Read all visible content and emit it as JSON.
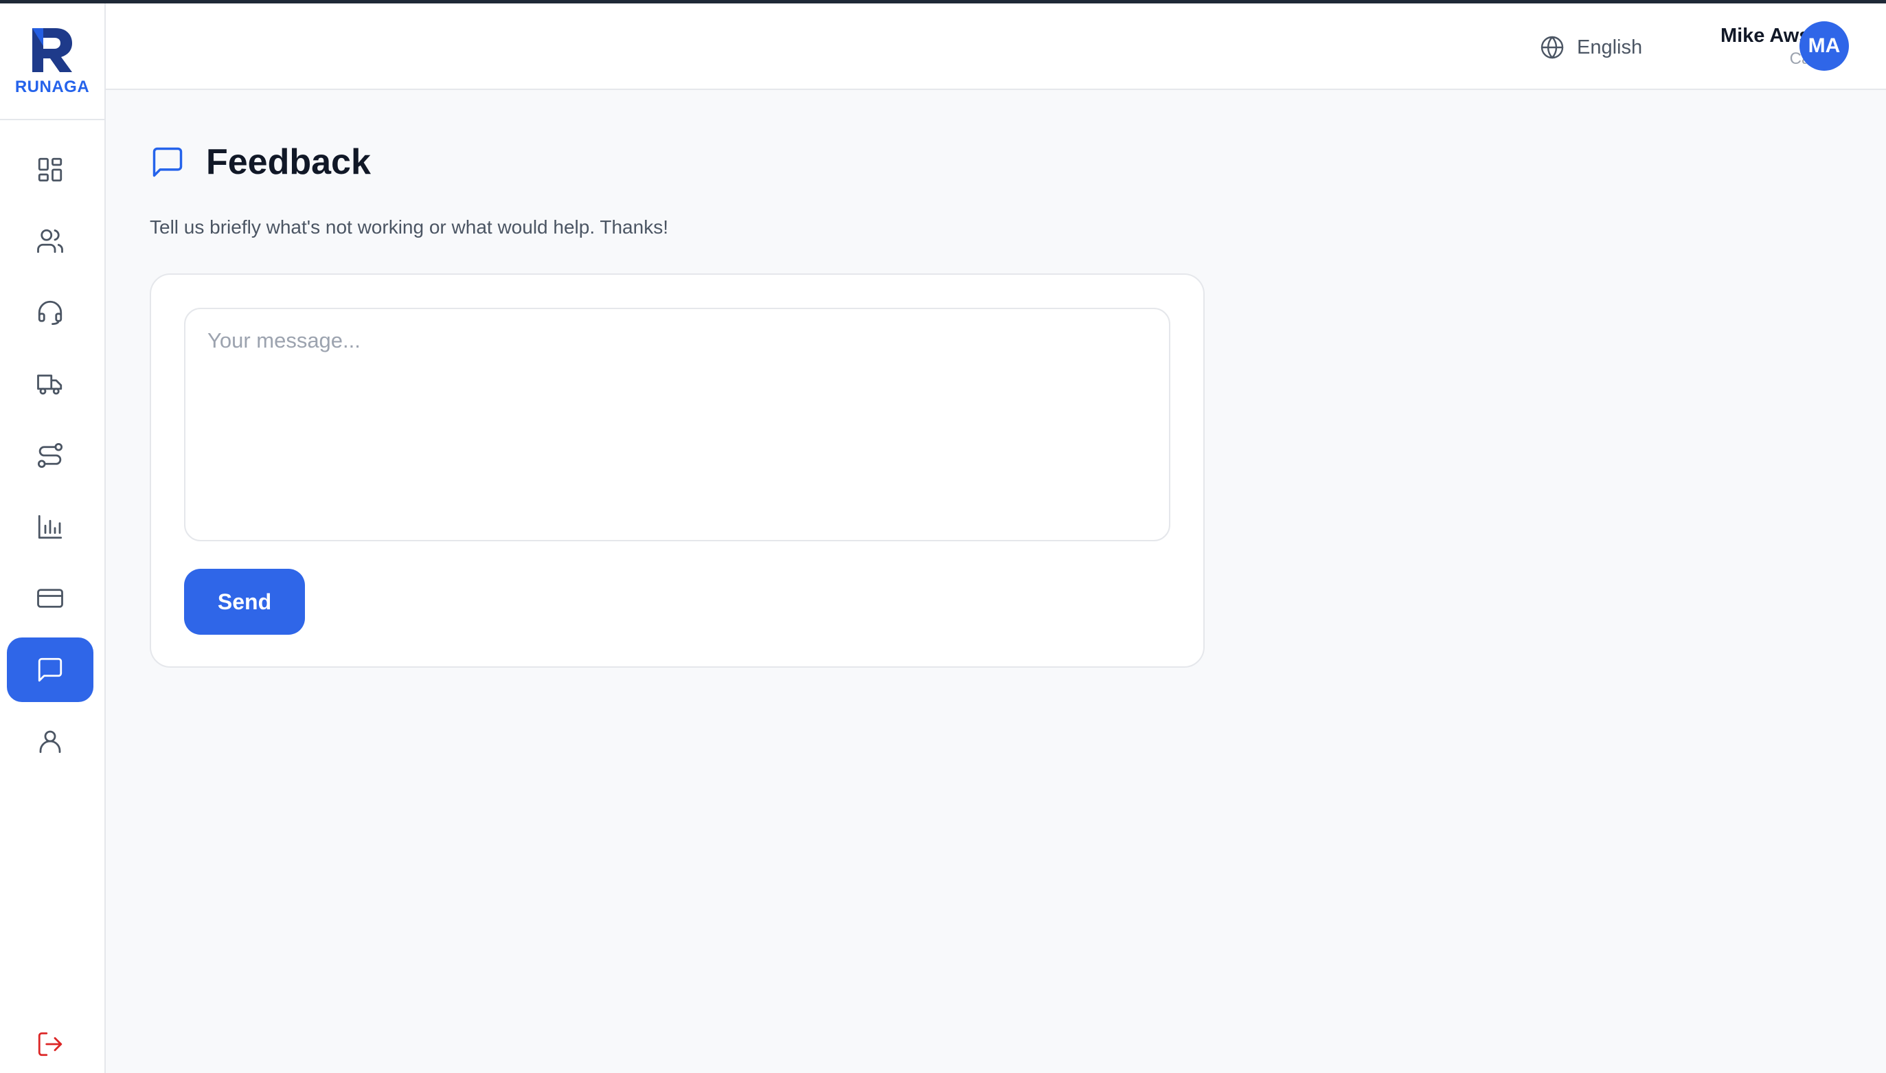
{
  "brand": {
    "name": "RUNAGA",
    "color": "#2563eb",
    "logo_letter_color": "#1e3a8a"
  },
  "sidebar": {
    "items": [
      {
        "icon": "dashboard-icon",
        "active": false
      },
      {
        "icon": "users-icon",
        "active": false
      },
      {
        "icon": "headset-icon",
        "active": false
      },
      {
        "icon": "truck-icon",
        "active": false
      },
      {
        "icon": "route-icon",
        "active": false
      },
      {
        "icon": "bar-chart-icon",
        "active": false
      },
      {
        "icon": "credit-card-icon",
        "active": false
      },
      {
        "icon": "message-square-icon",
        "active": true
      },
      {
        "icon": "user-icon",
        "active": false
      }
    ],
    "logout_icon": "logout-icon",
    "active_color": "#2f66e8",
    "logout_color": "#dc2626"
  },
  "header": {
    "language": {
      "icon": "globe-icon",
      "label": "English"
    },
    "user": {
      "name": "Mike Awsom",
      "role": "Carrier",
      "initials": "MA"
    }
  },
  "main": {
    "title_icon": "message-square-icon",
    "title": "Feedback",
    "subtitle": "Tell us briefly what's not working or what would help. Thanks!",
    "form": {
      "message_placeholder": "Your message...",
      "message_value": "",
      "send_label": "Send"
    }
  }
}
